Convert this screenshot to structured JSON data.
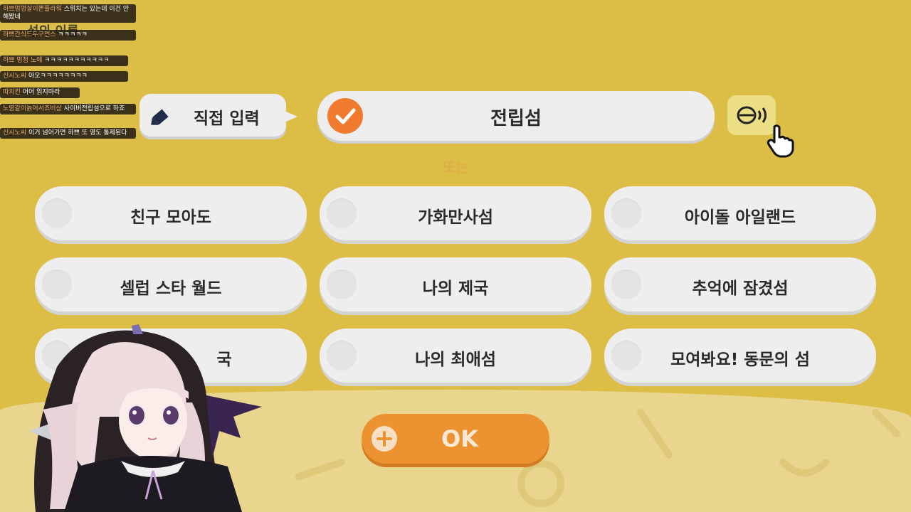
{
  "chat": [
    {
      "user": "하쁘멍멍살이쁜플라워",
      "text": "스위치는 있는데 이건 안해봤네"
    },
    {
      "user": "하쁘간식드두구먼스",
      "text": "ㅋㅋㅋㅋㅋ"
    },
    {
      "user": "하쁘 멍청 노예",
      "text": "ㅋㅋㅋㅋㅋㅋㅋㅋㅋㅋㅋ"
    },
    {
      "user": "신시노씨",
      "text": "아오ㅋㅋㅋㅋㅋㅋㅋㅋ"
    },
    {
      "user": "따치킨",
      "text": "어어 읽지마라"
    },
    {
      "user": "노땅같이늙어서쵸비상",
      "text": "사이버전립섬으로 하죠"
    },
    {
      "user": "신시노씨",
      "text": "이거 넘어가면 하쁘 또 영도 통제된다"
    }
  ],
  "ghost_title": "섬의 이름",
  "direct_input_label": "직접 입력",
  "name_value": "전립섬",
  "or_label": "또는",
  "options": [
    "친구 모아도",
    "가화만사섬",
    "아이돌 아일랜드",
    "셀럽 스타 월드",
    "나의 제국",
    "추억에 잠겼섬",
    "국",
    "나의 최애섬",
    "모여봐요! 동문의 섬"
  ],
  "ok_label": "OK",
  "colors": {
    "accent": "#f07b2e",
    "ok": "#ec9231",
    "bg": "#dcbd45"
  },
  "icons": {
    "direct": "pencil-icon",
    "check": "check-icon",
    "voice": "voice-speak-icon",
    "cursor": "hand-pointer-icon",
    "ok": "plus-icon"
  }
}
